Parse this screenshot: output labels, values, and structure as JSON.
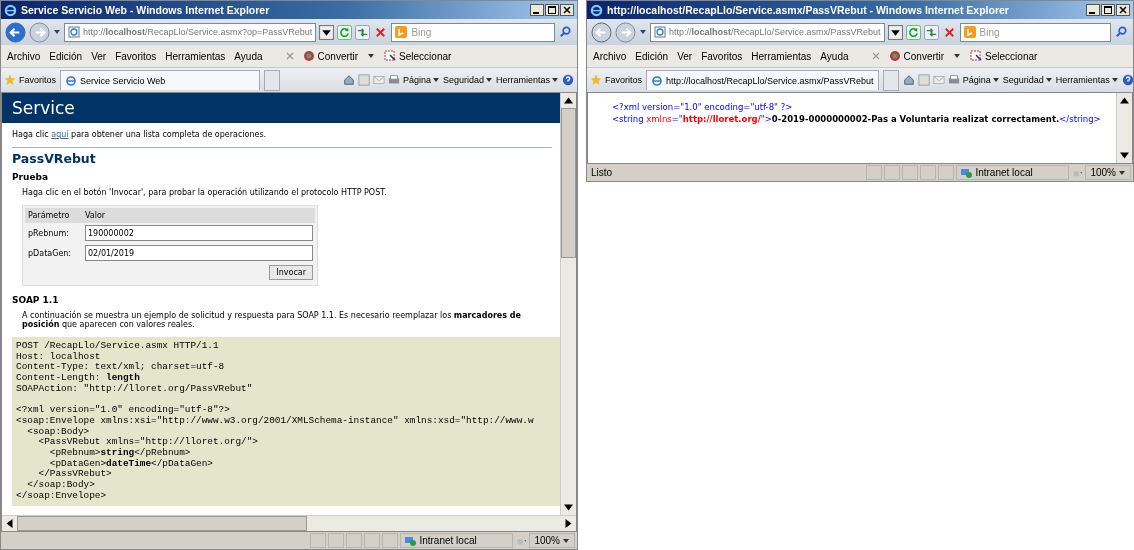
{
  "windows": [
    {
      "kind": "service",
      "title": "Service Servicio Web - Windows Internet Explorer",
      "address": "http://**localhost**/RecapLlo/Service.asmx?op=PassVRebut",
      "search_placeholder": "Bing",
      "menu": [
        "Archivo",
        "Edición",
        "Ver",
        "Favoritos",
        "Herramientas",
        "Ayuda"
      ],
      "toolbar": [
        "Convertir",
        "Seleccionar"
      ],
      "favorites": "Favoritos",
      "tab": "Service Servicio Web",
      "commands": [
        "Página",
        "Seguridad",
        "Herramientas"
      ],
      "zone": "Intranet local",
      "zoom": "100%",
      "page": {
        "banner": "Service",
        "intro": {
          "before": "Haga clic ",
          "link": "aquí",
          "after": " para obtener una lista completa de operaciones."
        },
        "operation": "PassVRebut",
        "test_heading": "Prueba",
        "test_text": "Haga clic en el botón 'Invocar', para probar la operación utilizando el protocolo HTTP POST.",
        "form": {
          "columns": [
            "Parámetro",
            "Valor"
          ],
          "rows": [
            {
              "label": "pRebnum:",
              "value": "190000002"
            },
            {
              "label": "pDataGen:",
              "value": "02/01/2019"
            }
          ],
          "button": "Invocar"
        },
        "soap_heading": "SOAP 1.1",
        "soap_text": "A continuación se muestra un ejemplo de solicitud y respuesta para SOAP 1.1. Es necesario reemplazar los **marcadores de posición** que aparecen con valores reales.",
        "code": {
          "headers": [
            "POST /RecapLlo/Service.asmx HTTP/1.1",
            "Host: localhost",
            "Content-Type: text/xml; charset=utf-8",
            "Content-Length: **length**",
            "SOAPAction: \"http://lloret.org/PassVRebut\""
          ],
          "body": [
            "<?xml version=\"1.0\" encoding=\"utf-8\"?>",
            "<soap:Envelope xmlns:xsi=\"http://www.w3.org/2001/XMLSchema-instance\" xmlns:xsd=\"http://www.w",
            "  <soap:Body>",
            "    <PassVRebut xmlns=\"http://lloret.org/\">",
            "      <pRebnum>**string**</pRebnum>",
            "      <pDataGen>**dateTime**</pDataGen>",
            "    </PassVRebut>",
            "  </soap:Body>",
            "</soap:Envelope>"
          ]
        }
      }
    },
    {
      "kind": "xml",
      "title": "http://localhost/RecapLlo/Service.asmx/PassVRebut - Windows Internet Explorer",
      "address": "http://**localhost**/RecapLlo/Service.asmx/PassVRebut",
      "search_placeholder": "Bing",
      "menu": [
        "Archivo",
        "Edición",
        "Ver",
        "Favoritos",
        "Herramientas",
        "Ayuda"
      ],
      "toolbar": [
        "Convertir",
        "Seleccionar"
      ],
      "favorites": "Favoritos",
      "tab": "http://localhost/RecapLlo/Service.asmx/PassVRebut",
      "commands": [
        "Página",
        "Seguridad",
        "Herramientas"
      ],
      "status_text": "Listo",
      "zone": "Intranet local",
      "zoom": "100%",
      "page": {
        "lines": [
          [
            {
              "kind": "tag",
              "text": "<?xml version=\"1.0\" encoding=\"utf-8\" ?>"
            }
          ],
          [
            {
              "kind": "tag",
              "text": "<string "
            },
            {
              "kind": "attr",
              "text": "xmlns"
            },
            {
              "kind": "tag",
              "text": "=\""
            },
            {
              "kind": "value",
              "text": "http://lloret.org/"
            },
            {
              "kind": "tag",
              "text": "\">"
            },
            {
              "kind": "text",
              "text": "0-2019-0000000002-Pas a Voluntaria realizat correctament."
            },
            {
              "kind": "tag",
              "text": "</string>"
            }
          ]
        ]
      }
    }
  ]
}
